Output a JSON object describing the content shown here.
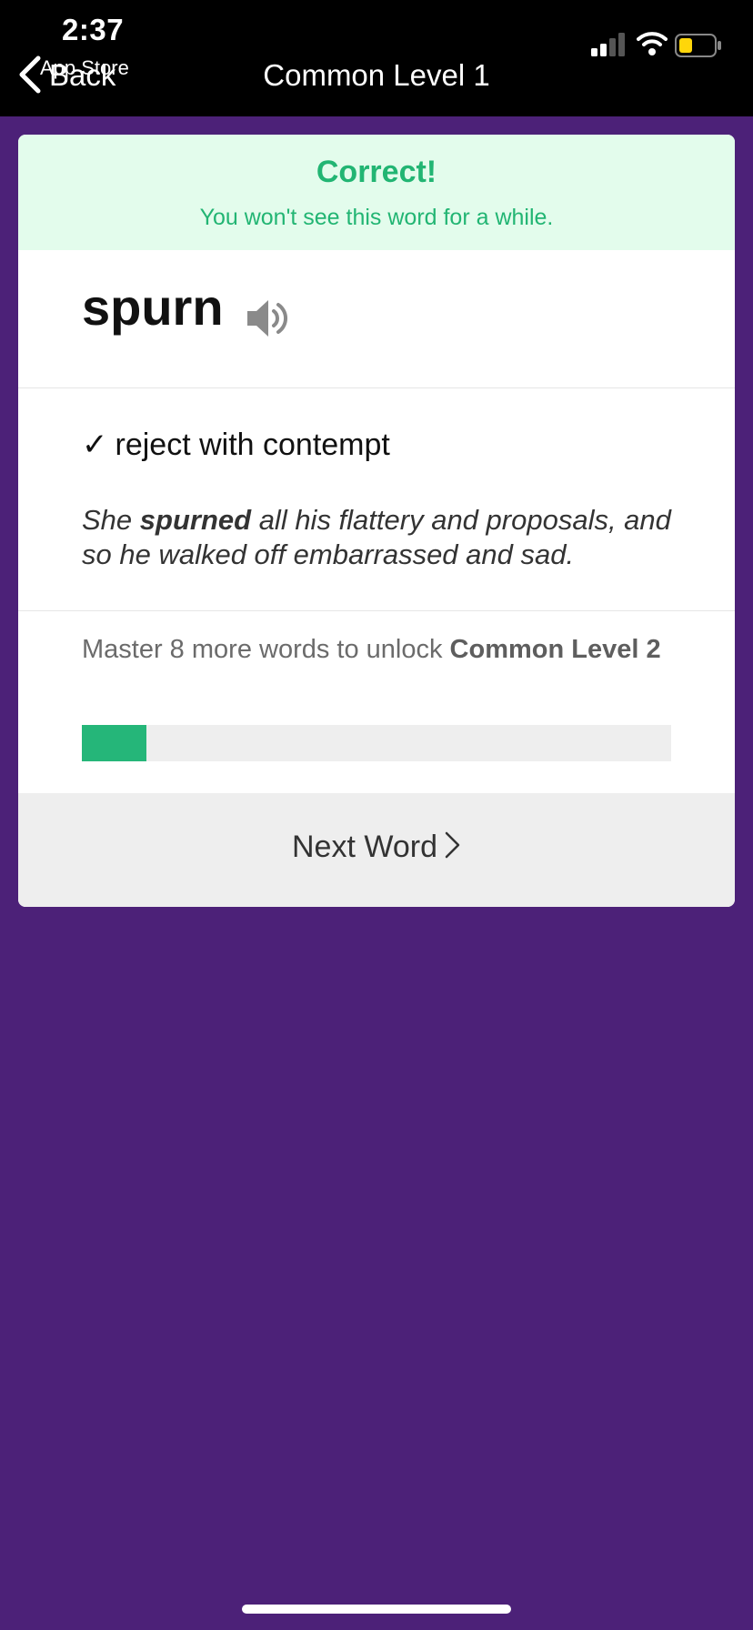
{
  "status_bar": {
    "time": "2:37",
    "back_app": "App Store",
    "battery_color": "#ffd60a"
  },
  "nav": {
    "back_label": "Back",
    "title": "Common Level 1"
  },
  "banner": {
    "title": "Correct!",
    "subtitle": "You won't see this word for a while.",
    "color": "#22b573"
  },
  "word": {
    "text": "spurn",
    "audio_icon": "speaker-icon"
  },
  "definition": {
    "check": "✓",
    "text": "reject with contempt"
  },
  "example": {
    "before": "She ",
    "highlight": "spurned",
    "after": " all his flattery and proposals, and so he walked off embarrassed and sad."
  },
  "progress": {
    "prefix": "Master 8 more words to unlock ",
    "target": "Common Level 2",
    "fraction": 0.11
  },
  "next_button": {
    "label": "Next Word"
  },
  "colors": {
    "background": "#4c2178",
    "accent": "#25b679"
  }
}
